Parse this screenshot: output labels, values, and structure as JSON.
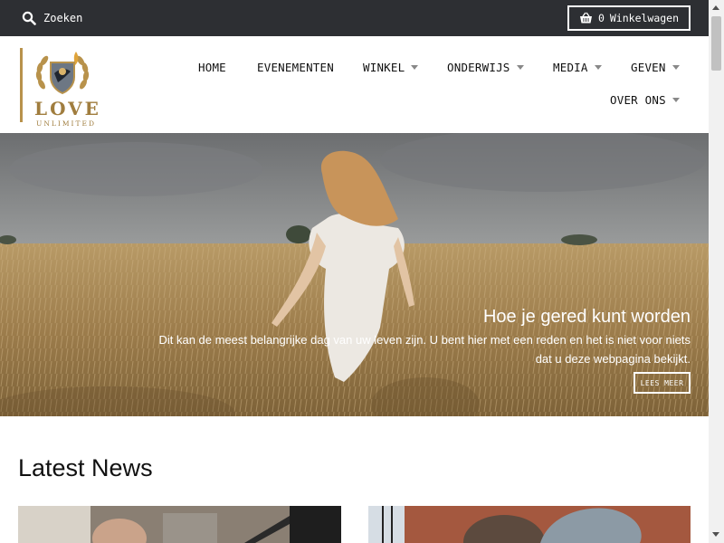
{
  "topbar": {
    "search_label": "Zoeken",
    "cart_count": "0",
    "cart_label": "Winkelwagen"
  },
  "logo": {
    "word": "LOVE",
    "sub": "UNLIMITED",
    "accent_color": "#b8924b"
  },
  "nav": {
    "items": [
      {
        "label": "HOME",
        "has_dropdown": false
      },
      {
        "label": "EVENEMENTEN",
        "has_dropdown": false
      },
      {
        "label": "WINKEL",
        "has_dropdown": true
      },
      {
        "label": "ONDERWIJS",
        "has_dropdown": true
      },
      {
        "label": "MEDIA",
        "has_dropdown": true
      },
      {
        "label": "GEVEN",
        "has_dropdown": true
      },
      {
        "label": "OVER ONS",
        "has_dropdown": true
      }
    ]
  },
  "hero": {
    "title": "Hoe je gered kunt worden",
    "text": "Dit kan de meest belangrijke dag van uw leven zijn. U bent hier met een reden en het is niet voor niets dat u deze webpagina bekijkt.",
    "button_label": "LEES MEER"
  },
  "news": {
    "heading": "Latest News"
  },
  "colors": {
    "topbar_bg": "#2d2f33",
    "gold": "#b8924b"
  }
}
